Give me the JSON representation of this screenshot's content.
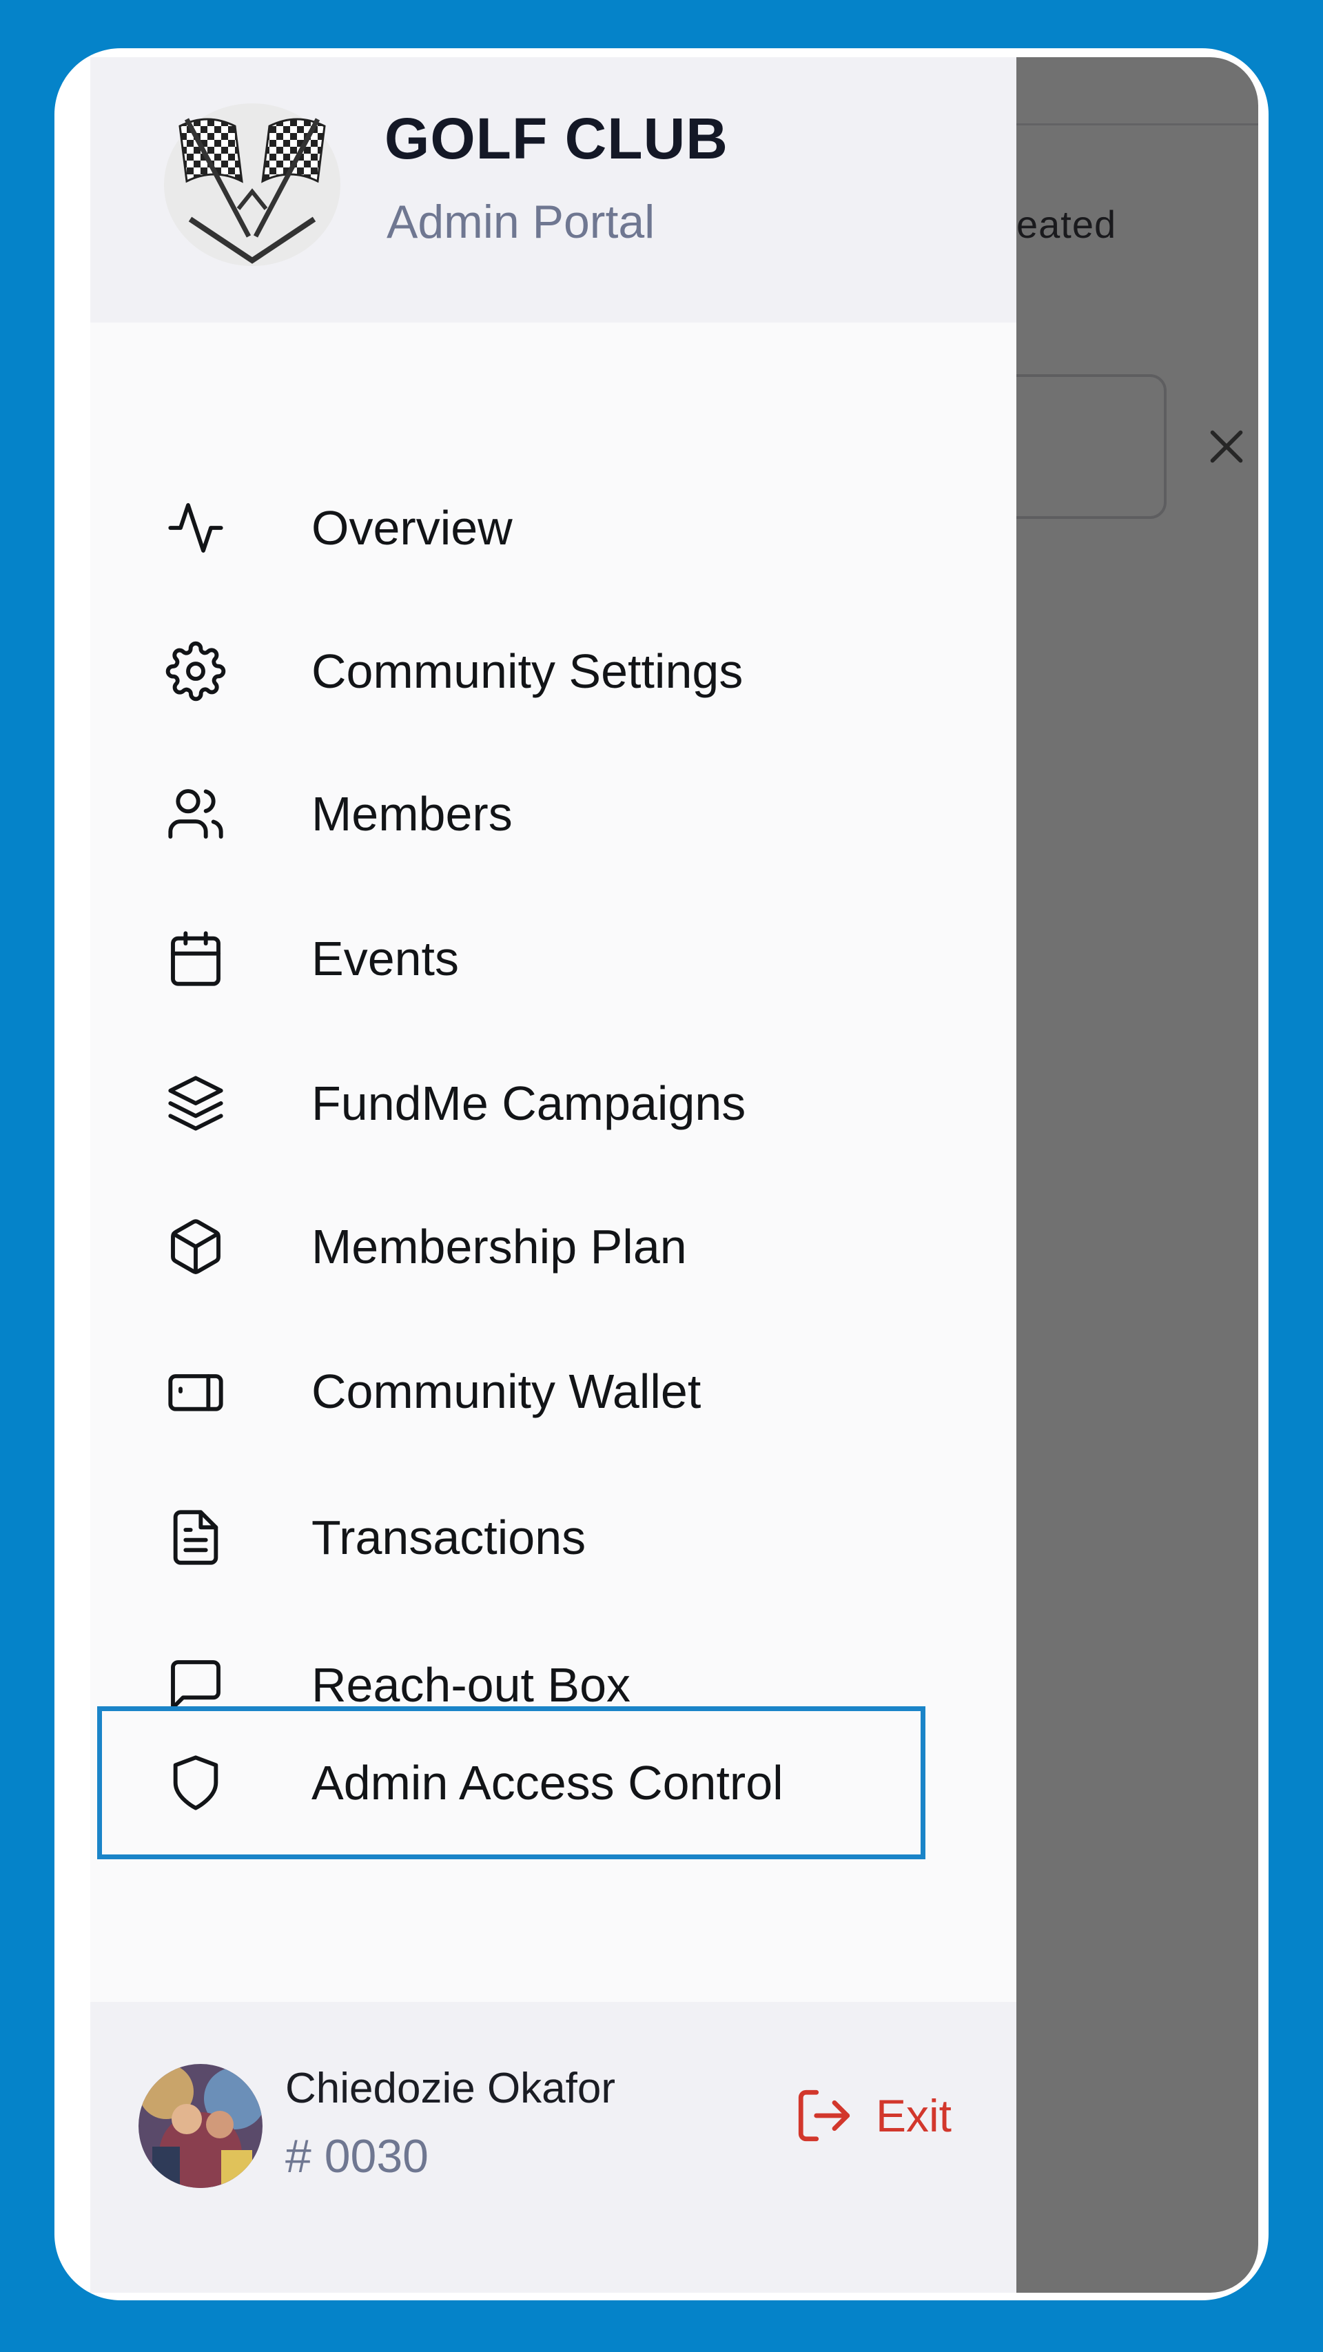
{
  "header": {
    "title": "GOLF CLUB",
    "subtitle": "Admin Portal"
  },
  "background": {
    "created_text": "eated"
  },
  "nav": {
    "items": [
      {
        "label": "Overview",
        "icon": "activity-icon"
      },
      {
        "label": "Community Settings",
        "icon": "gear-icon"
      },
      {
        "label": "Members",
        "icon": "users-icon"
      },
      {
        "label": "Events",
        "icon": "calendar-icon"
      },
      {
        "label": "FundMe Campaigns",
        "icon": "layers-icon"
      },
      {
        "label": "Membership Plan",
        "icon": "package-icon"
      },
      {
        "label": "Community Wallet",
        "icon": "wallet-icon"
      },
      {
        "label": "Transactions",
        "icon": "file-text-icon"
      },
      {
        "label": "Reach-out Box",
        "icon": "message-square-icon"
      },
      {
        "label": "Admin Access Control",
        "icon": "shield-icon",
        "active": true
      }
    ]
  },
  "footer": {
    "user_name": "Chiedozie Okafor",
    "user_id": "# 0030",
    "exit_label": "Exit"
  },
  "colors": {
    "page_background": "#0583C9",
    "active_border": "#1A84C8",
    "exit": "#D2372C",
    "muted_text": "#6F7791"
  }
}
